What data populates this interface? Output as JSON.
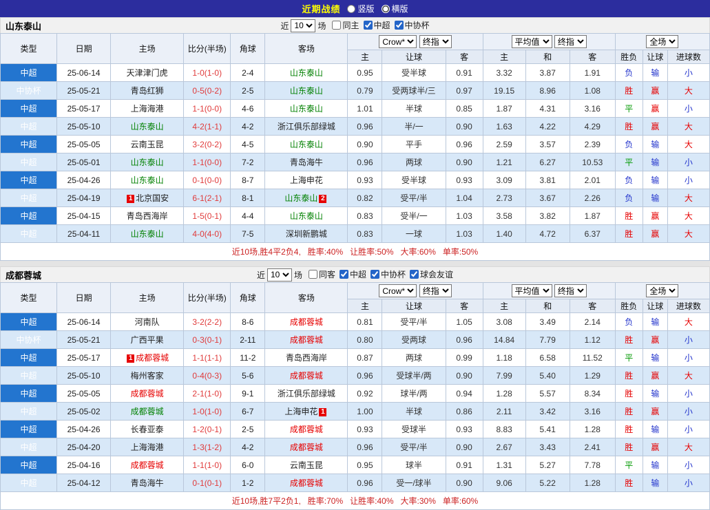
{
  "palette": {
    "topbar_bg": "#2c2d9e",
    "title_yellow": "#ffff00",
    "csl_blue": "#2375cf",
    "cup_blue": "#4187c0",
    "alt_row": "#d8e8f8",
    "border": "#b9c7da",
    "team_green": "#008000",
    "team_red": "#e60000",
    "team_black": "#222222",
    "win_red": "#e60000",
    "draw_green": "#009900",
    "lose_blue": "#2233cc",
    "score_red": "#e03a3a",
    "footer_red": "#cc2222"
  },
  "topbar": {
    "title": "近期战绩",
    "radios": [
      {
        "label": "竖版",
        "checked": false
      },
      {
        "label": "横版",
        "checked": true
      }
    ]
  },
  "header": {
    "type": "类型",
    "date": "日期",
    "home": "主场",
    "score": "比分(半场)",
    "corner": "角球",
    "away": "客场",
    "dd": [
      "Crow*",
      "终指",
      "平均值",
      "终指",
      "全场"
    ],
    "sub": [
      "主",
      "让球",
      "客",
      "主",
      "和",
      "客",
      "胜负",
      "让球",
      "进球数"
    ]
  },
  "tables": [
    {
      "team": "山东泰山",
      "filter": {
        "near": "近",
        "n": "10",
        "games": "场",
        "checks": [
          {
            "label": "同主",
            "checked": false
          },
          {
            "label": "中超",
            "checked": true
          },
          {
            "label": "中协杯",
            "checked": true
          }
        ]
      },
      "rows": [
        {
          "lg": "中超",
          "dt": "25-06-14",
          "hm": "天津津门虎",
          "hc": "black",
          "hb": null,
          "sc": "1-0(1-0)",
          "cn": "2-4",
          "aw": "山东泰山",
          "ac": "green",
          "ab": null,
          "o": [
            "0.95",
            "受半球",
            "0.91"
          ],
          "a": [
            "3.32",
            "3.87",
            "1.91"
          ],
          "res": [
            "负",
            "输",
            "小"
          ]
        },
        {
          "lg": "中协杯",
          "dt": "25-05-21",
          "hm": "青岛红狮",
          "hc": "black",
          "hb": null,
          "sc": "0-5(0-2)",
          "cn": "2-5",
          "aw": "山东泰山",
          "ac": "green",
          "ab": null,
          "o": [
            "0.79",
            "受两球半/三",
            "0.97"
          ],
          "a": [
            "19.15",
            "8.96",
            "1.08"
          ],
          "res": [
            "胜",
            "赢",
            "大"
          ]
        },
        {
          "lg": "中超",
          "dt": "25-05-17",
          "hm": "上海海港",
          "hc": "black",
          "hb": null,
          "sc": "1-1(0-0)",
          "cn": "4-6",
          "aw": "山东泰山",
          "ac": "green",
          "ab": null,
          "o": [
            "1.01",
            "半球",
            "0.85"
          ],
          "a": [
            "1.87",
            "4.31",
            "3.16"
          ],
          "res": [
            "平",
            "赢",
            "小"
          ]
        },
        {
          "lg": "中超",
          "dt": "25-05-10",
          "hm": "山东泰山",
          "hc": "green",
          "hb": null,
          "sc": "4-2(1-1)",
          "cn": "4-2",
          "aw": "浙江俱乐部绿城",
          "ac": "black",
          "ab": null,
          "o": [
            "0.96",
            "半/一",
            "0.90"
          ],
          "a": [
            "1.63",
            "4.22",
            "4.29"
          ],
          "res": [
            "胜",
            "赢",
            "大"
          ]
        },
        {
          "lg": "中超",
          "dt": "25-05-05",
          "hm": "云南玉昆",
          "hc": "black",
          "hb": null,
          "sc": "3-2(0-2)",
          "cn": "4-5",
          "aw": "山东泰山",
          "ac": "green",
          "ab": null,
          "o": [
            "0.90",
            "平手",
            "0.96"
          ],
          "a": [
            "2.59",
            "3.57",
            "2.39"
          ],
          "res": [
            "负",
            "输",
            "大"
          ]
        },
        {
          "lg": "中超",
          "dt": "25-05-01",
          "hm": "山东泰山",
          "hc": "green",
          "hb": null,
          "sc": "1-1(0-0)",
          "cn": "7-2",
          "aw": "青岛海牛",
          "ac": "black",
          "ab": null,
          "o": [
            "0.96",
            "两球",
            "0.90"
          ],
          "a": [
            "1.21",
            "6.27",
            "10.53"
          ],
          "res": [
            "平",
            "输",
            "小"
          ]
        },
        {
          "lg": "中超",
          "dt": "25-04-26",
          "hm": "山东泰山",
          "hc": "green",
          "hb": null,
          "sc": "0-1(0-0)",
          "cn": "8-7",
          "aw": "上海申花",
          "ac": "black",
          "ab": null,
          "o": [
            "0.93",
            "受半球",
            "0.93"
          ],
          "a": [
            "3.09",
            "3.81",
            "2.01"
          ],
          "res": [
            "负",
            "输",
            "小"
          ]
        },
        {
          "lg": "中超",
          "dt": "25-04-19",
          "hm": "北京国安",
          "hc": "black",
          "hb": "1",
          "sc": "6-1(2-1)",
          "cn": "8-1",
          "aw": "山东泰山",
          "ac": "green",
          "ab": "2",
          "o": [
            "0.82",
            "受平/半",
            "1.04"
          ],
          "a": [
            "2.73",
            "3.67",
            "2.26"
          ],
          "res": [
            "负",
            "输",
            "大"
          ]
        },
        {
          "lg": "中超",
          "dt": "25-04-15",
          "hm": "青岛西海岸",
          "hc": "black",
          "hb": null,
          "sc": "1-5(0-1)",
          "cn": "4-4",
          "aw": "山东泰山",
          "ac": "green",
          "ab": null,
          "o": [
            "0.83",
            "受半/一",
            "1.03"
          ],
          "a": [
            "3.58",
            "3.82",
            "1.87"
          ],
          "res": [
            "胜",
            "赢",
            "大"
          ]
        },
        {
          "lg": "中超",
          "dt": "25-04-11",
          "hm": "山东泰山",
          "hc": "green",
          "hb": null,
          "sc": "4-0(4-0)",
          "cn": "7-5",
          "aw": "深圳新鹏城",
          "ac": "black",
          "ab": null,
          "o": [
            "0.83",
            "一球",
            "1.03"
          ],
          "a": [
            "1.40",
            "4.72",
            "6.37"
          ],
          "res": [
            "胜",
            "赢",
            "大"
          ]
        }
      ],
      "footer": [
        "近10场,胜4平2负4,",
        "胜率:40%",
        "让胜率:50%",
        "大率:60%",
        "单率:50%"
      ]
    },
    {
      "team": "成都蓉城",
      "filter": {
        "near": "近",
        "n": "10",
        "games": "场",
        "checks": [
          {
            "label": "同客",
            "checked": false
          },
          {
            "label": "中超",
            "checked": true
          },
          {
            "label": "中协杯",
            "checked": true
          },
          {
            "label": "球会友谊",
            "checked": true
          }
        ]
      },
      "rows": [
        {
          "lg": "中超",
          "dt": "25-06-14",
          "hm": "河南队",
          "hc": "black",
          "hb": null,
          "sc": "3-2(2-2)",
          "cn": "8-6",
          "aw": "成都蓉城",
          "ac": "red",
          "ab": null,
          "o": [
            "0.81",
            "受平/半",
            "1.05"
          ],
          "a": [
            "3.08",
            "3.49",
            "2.14"
          ],
          "res": [
            "负",
            "输",
            "大"
          ]
        },
        {
          "lg": "中协杯",
          "dt": "25-05-21",
          "hm": "广西平果",
          "hc": "black",
          "hb": null,
          "sc": "0-3(0-1)",
          "cn": "2-11",
          "aw": "成都蓉城",
          "ac": "red",
          "ab": null,
          "o": [
            "0.80",
            "受两球",
            "0.96"
          ],
          "a": [
            "14.84",
            "7.79",
            "1.12"
          ],
          "res": [
            "胜",
            "赢",
            "小"
          ]
        },
        {
          "lg": "中超",
          "dt": "25-05-17",
          "hm": "成都蓉城",
          "hc": "red",
          "hb": "1",
          "sc": "1-1(1-1)",
          "cn": "11-2",
          "aw": "青岛西海岸",
          "ac": "black",
          "ab": null,
          "o": [
            "0.87",
            "两球",
            "0.99"
          ],
          "a": [
            "1.18",
            "6.58",
            "11.52"
          ],
          "res": [
            "平",
            "输",
            "小"
          ]
        },
        {
          "lg": "中超",
          "dt": "25-05-10",
          "hm": "梅州客家",
          "hc": "black",
          "hb": null,
          "sc": "0-4(0-3)",
          "cn": "5-6",
          "aw": "成都蓉城",
          "ac": "red",
          "ab": null,
          "o": [
            "0.96",
            "受球半/两",
            "0.90"
          ],
          "a": [
            "7.99",
            "5.40",
            "1.29"
          ],
          "res": [
            "胜",
            "赢",
            "大"
          ]
        },
        {
          "lg": "中超",
          "dt": "25-05-05",
          "hm": "成都蓉城",
          "hc": "red",
          "hb": null,
          "sc": "2-1(1-0)",
          "cn": "9-1",
          "aw": "浙江俱乐部绿城",
          "ac": "black",
          "ab": null,
          "o": [
            "0.92",
            "球半/两",
            "0.94"
          ],
          "a": [
            "1.28",
            "5.57",
            "8.34"
          ],
          "res": [
            "胜",
            "输",
            "小"
          ]
        },
        {
          "lg": "中超",
          "dt": "25-05-02",
          "hm": "成都蓉城",
          "hc": "green",
          "hb": null,
          "sc": "1-0(1-0)",
          "cn": "6-7",
          "aw": "上海申花",
          "ac": "black",
          "ab": "1",
          "o": [
            "1.00",
            "半球",
            "0.86"
          ],
          "a": [
            "2.11",
            "3.42",
            "3.16"
          ],
          "res": [
            "胜",
            "赢",
            "小"
          ]
        },
        {
          "lg": "中超",
          "dt": "25-04-26",
          "hm": "长春亚泰",
          "hc": "black",
          "hb": null,
          "sc": "1-2(0-1)",
          "cn": "2-5",
          "aw": "成都蓉城",
          "ac": "red",
          "ab": null,
          "o": [
            "0.93",
            "受球半",
            "0.93"
          ],
          "a": [
            "8.83",
            "5.41",
            "1.28"
          ],
          "res": [
            "胜",
            "输",
            "小"
          ]
        },
        {
          "lg": "中超",
          "dt": "25-04-20",
          "hm": "上海海港",
          "hc": "black",
          "hb": null,
          "sc": "1-3(1-2)",
          "cn": "4-2",
          "aw": "成都蓉城",
          "ac": "red",
          "ab": null,
          "o": [
            "0.96",
            "受平/半",
            "0.90"
          ],
          "a": [
            "2.67",
            "3.43",
            "2.41"
          ],
          "res": [
            "胜",
            "赢",
            "大"
          ]
        },
        {
          "lg": "中超",
          "dt": "25-04-16",
          "hm": "成都蓉城",
          "hc": "red",
          "hb": null,
          "sc": "1-1(1-0)",
          "cn": "6-0",
          "aw": "云南玉昆",
          "ac": "black",
          "ab": null,
          "o": [
            "0.95",
            "球半",
            "0.91"
          ],
          "a": [
            "1.31",
            "5.27",
            "7.78"
          ],
          "res": [
            "平",
            "输",
            "小"
          ]
        },
        {
          "lg": "中超",
          "dt": "25-04-12",
          "hm": "青岛海牛",
          "hc": "black",
          "hb": null,
          "sc": "0-1(0-1)",
          "cn": "1-2",
          "aw": "成都蓉城",
          "ac": "red",
          "ab": null,
          "o": [
            "0.96",
            "受一/球半",
            "0.90"
          ],
          "a": [
            "9.06",
            "5.22",
            "1.28"
          ],
          "res": [
            "胜",
            "输",
            "小"
          ]
        }
      ],
      "footer": [
        "近10场,胜7平2负1,",
        "胜率:70%",
        "让胜率:40%",
        "大率:30%",
        "单率:60%"
      ]
    }
  ]
}
